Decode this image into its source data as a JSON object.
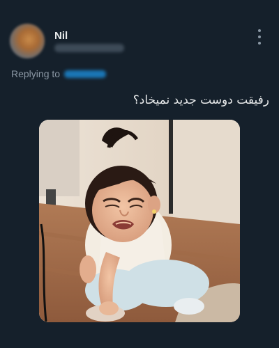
{
  "author": {
    "name": "Nil",
    "handle": "@nilnil_2004"
  },
  "reply": {
    "label": "Replying to",
    "handle": "@aydin_dd"
  },
  "tweet": {
    "text": "رفیقت دوست جدید نمیخاد؟"
  },
  "media": {
    "subject": "crying toddler sitting on floor",
    "alt": "Crying toddler crouching on a wooden floor"
  },
  "icons": {
    "more": "more-vertical-icon"
  },
  "colors": {
    "background": "#15202b",
    "text": "#e7e9ea",
    "secondary": "#8b98a5",
    "accent": "#1d9bf0"
  }
}
